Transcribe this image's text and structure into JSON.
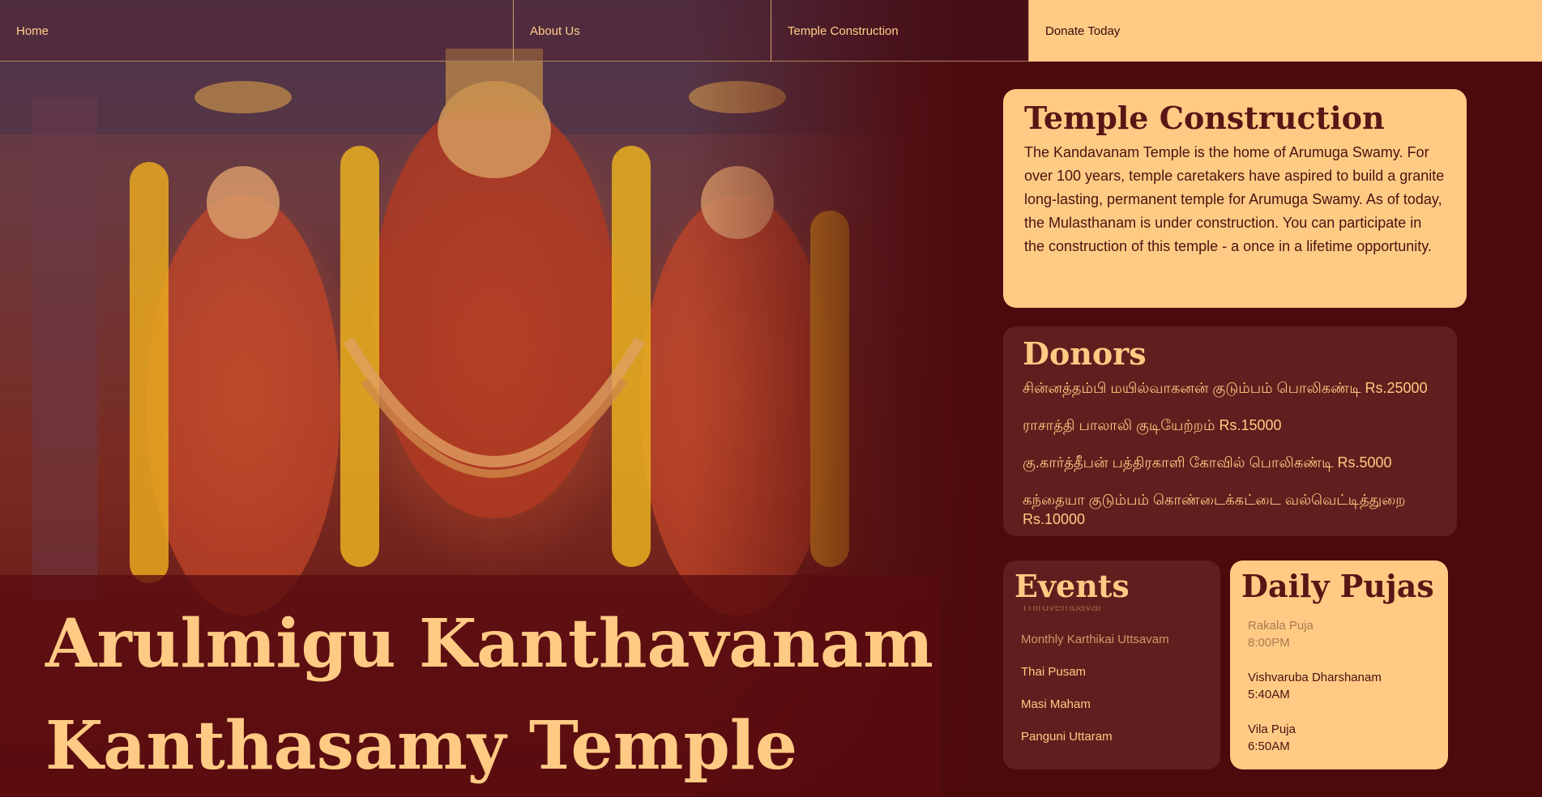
{
  "nav": {
    "items": [
      {
        "label": "Home"
      },
      {
        "label": "About Us"
      },
      {
        "label": "Temple Construction"
      }
    ],
    "donate_label": "Donate Today"
  },
  "hero": {
    "image": "temple-deities-image",
    "title": "Arulmigu Kanthavanam Kanthasamy Temple"
  },
  "construction": {
    "title": "Temple Construction",
    "body": "The Kandavanam Temple is the home of Arumuga Swamy. For over 100 years, temple caretakers have aspired to build a granite long-lasting, permanent temple for Arumuga Swamy. As of today, the Mulasthanam is under construction. You can participate in the construction of this temple - a once in a lifetime opportunity."
  },
  "donors": {
    "title": "Donors",
    "items": [
      "சின்னத்தம்பி மயில்வாகனன் குடும்பம் பொலிகண்டி Rs.25000",
      "ராசாத்தி பாலாலி குடியேற்றம் Rs.15000",
      "கு.கார்த்தீபன் பத்திரகாளி கோவில் பொலிகண்டி Rs.5000",
      "கந்தையா குடும்பம் கொண்டைக்கட்டை வல்வெட்டித்துறை Rs.10000"
    ]
  },
  "events": {
    "title": "Events",
    "items": [
      "Thiruvembavai",
      "Monthly Karthikai Uttsavam",
      "Thai Pusam",
      "Masi Maham",
      "Panguni Uttaram"
    ]
  },
  "pujas": {
    "title": "Daily Pujas",
    "items": [
      {
        "name": "Rakala Puja",
        "time": "8:00PM"
      },
      {
        "name": "Vishvaruba Dharshanam",
        "time": "5:40AM"
      },
      {
        "name": "Vila Puja",
        "time": "6:50AM"
      }
    ]
  },
  "colors": {
    "background": "#4d0a0d",
    "accent": "#ffcb84",
    "card_dark": "#611e1e",
    "text_dark": "#4a1212"
  }
}
